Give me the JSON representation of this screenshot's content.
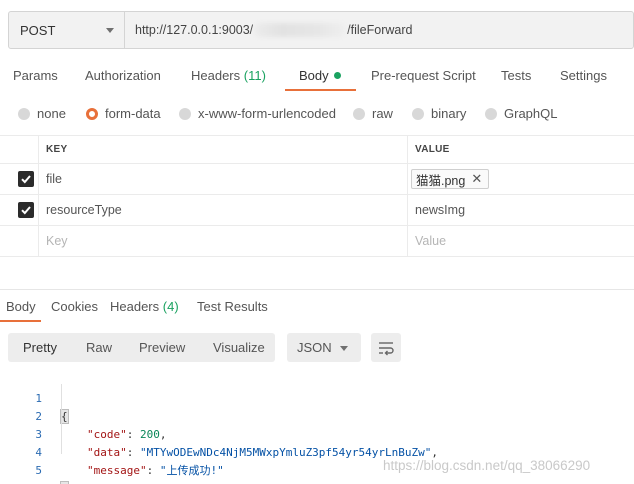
{
  "request": {
    "method": "POST",
    "url_prefix": "http://127.0.0.1:9003/",
    "url_suffix": "/fileForward"
  },
  "tabs": [
    {
      "label": "Params"
    },
    {
      "label": "Authorization"
    },
    {
      "label": "Headers",
      "count": "(11)"
    },
    {
      "label": "Body",
      "active": true
    },
    {
      "label": "Pre-request Script"
    },
    {
      "label": "Tests"
    },
    {
      "label": "Settings"
    }
  ],
  "body_types": [
    {
      "label": "none",
      "selected": false
    },
    {
      "label": "form-data",
      "selected": true
    },
    {
      "label": "x-www-form-urlencoded",
      "selected": false
    },
    {
      "label": "raw",
      "selected": false
    },
    {
      "label": "binary",
      "selected": false
    },
    {
      "label": "GraphQL",
      "selected": false
    }
  ],
  "params_table": {
    "headers": {
      "key": "KEY",
      "value": "VALUE"
    },
    "rows": [
      {
        "checked": true,
        "key": "file",
        "value": "猫猫.png",
        "is_file": true
      },
      {
        "checked": true,
        "key": "resourceType",
        "value": "newsImg",
        "is_file": false
      }
    ],
    "placeholder": {
      "key": "Key",
      "value": "Value"
    }
  },
  "response_tabs": [
    {
      "label": "Body",
      "active": true
    },
    {
      "label": "Cookies"
    },
    {
      "label": "Headers",
      "count": "(4)"
    },
    {
      "label": "Test Results"
    }
  ],
  "view_modes": [
    "Pretty",
    "Raw",
    "Preview",
    "Visualize"
  ],
  "active_view_mode": "Pretty",
  "format": "JSON",
  "response_body": {
    "line_numbers": [
      "1",
      "2",
      "3",
      "4",
      "5"
    ],
    "open_brace": "{",
    "close_brace": "}",
    "fields": [
      {
        "key": "\"code\"",
        "value": "200",
        "sep": ": ",
        "trail": ",",
        "type": "number"
      },
      {
        "key": "\"data\"",
        "value": "\"MTYwODEwNDc4NjM5MWxpYmluZ3pf54yr54yrLnBuZw\"",
        "sep": ": ",
        "trail": ",",
        "type": "string"
      },
      {
        "key": "\"message\"",
        "value": "\"上传成功!\"",
        "sep": ": ",
        "trail": "",
        "type": "string"
      }
    ]
  },
  "watermark": "https://blog.csdn.net/qq_38066290",
  "icons": {
    "method_dropdown": "chevron-down-icon",
    "check": "check-icon",
    "remove_file": "close-icon",
    "wrap": "wrap-lines-icon"
  },
  "colors": {
    "accent": "#e8703a",
    "status_green": "#1aa260",
    "code_key": "#a31515",
    "code_string": "#0451a5",
    "code_number": "#098658",
    "line_number": "#2b6bb2"
  }
}
